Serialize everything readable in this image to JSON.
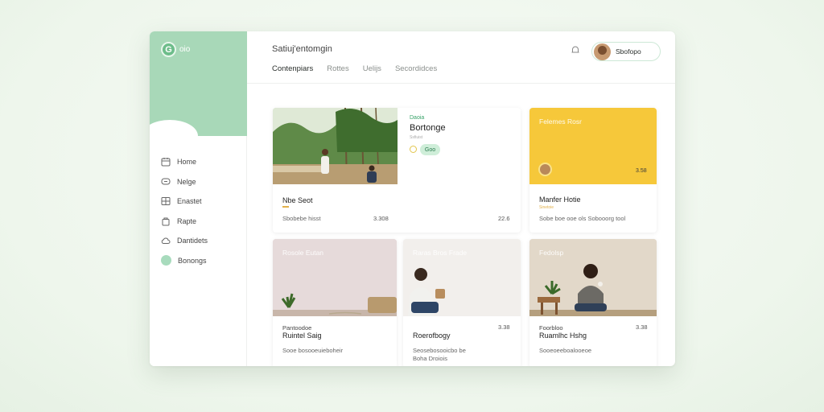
{
  "app": {
    "brand_initial": "G",
    "brand_name": "oio"
  },
  "sidebar": {
    "items": [
      {
        "label": "Home",
        "icon": "calendar-icon"
      },
      {
        "label": "Nelge",
        "icon": "chat-icon"
      },
      {
        "label": "Enastet",
        "icon": "grid-icon"
      },
      {
        "label": "Rapte",
        "icon": "bag-icon"
      },
      {
        "label": "Dantidets",
        "icon": "cloud-icon"
      },
      {
        "label": "Bonongs",
        "icon": "dot-icon",
        "active": true
      }
    ]
  },
  "header": {
    "title": "Satiuj'entomgin",
    "tabs": [
      {
        "label": "Contenpiars",
        "active": true
      },
      {
        "label": "Rottes"
      },
      {
        "label": "Uelijs"
      },
      {
        "label": "Secordidces"
      }
    ],
    "user_name": "Sbofopo"
  },
  "cards": {
    "featured": {
      "eyebrow": "Daoia",
      "title": "Bortonge",
      "meta": "Ssfiuist",
      "badge": "Goo",
      "name": "Nbe Seot",
      "subtitle": "Sbobebe hisst",
      "price": "3.308",
      "price2": "22.6"
    },
    "yellow": {
      "overlay": "Felemes Rosr",
      "price_badge": "3.58",
      "title": "Manfer Hotie",
      "meta": "Sinetoie",
      "subtitle": "Sobe boe ooe ols Sobooorg tool"
    },
    "bottom1": {
      "overlay": "Rosole Eutan",
      "eyebrow": "Pantoodoe",
      "title": "Ruintel Saig",
      "subtitle": "Sooe bosooeuieboheir"
    },
    "bottom2": {
      "overlay": "Raras Bros Frade",
      "price": "3.38",
      "title": "Roerofbogy",
      "subtitle": "Seosebosooicbo be",
      "subtitle2": "Boha Droiois"
    },
    "bottom3": {
      "overlay": "Fedolsp",
      "eyebrow": "Foorbloo",
      "title": "Ruamlhc Hshg",
      "price": "3.38",
      "subtitle": "Sooeoeeboalooeoe"
    }
  },
  "colors": {
    "accent": "#6dbd8a",
    "sidebar_hero": "#a8d8b8",
    "yellow_card": "#f6c83a",
    "price_accent": "#e2b14c"
  }
}
